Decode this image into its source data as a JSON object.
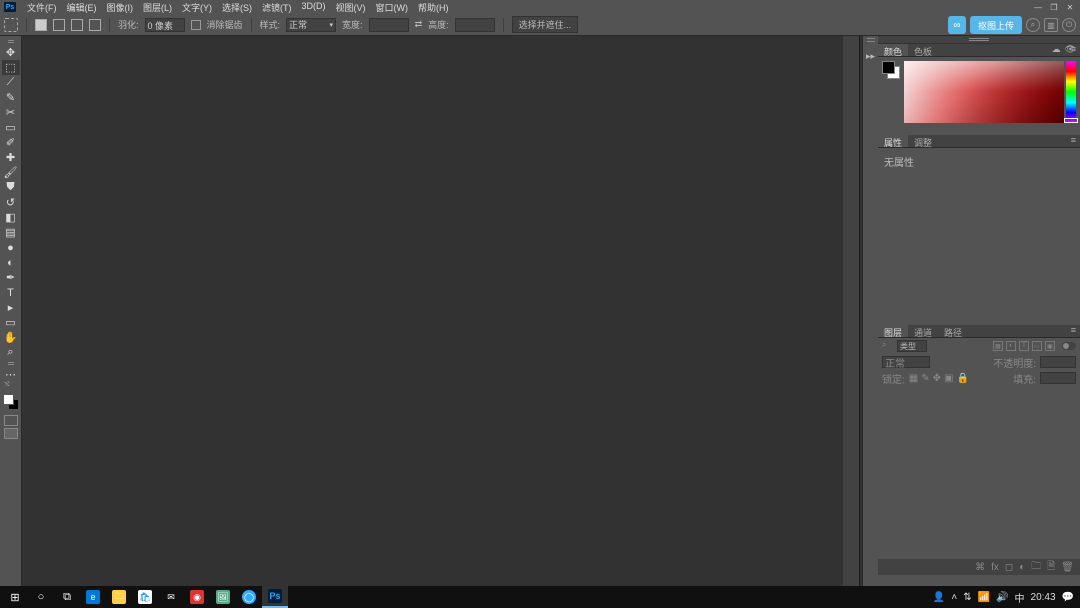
{
  "app": {
    "short": "Ps"
  },
  "menu": [
    "文件(F)",
    "编辑(E)",
    "图像(I)",
    "图层(L)",
    "文字(Y)",
    "选择(S)",
    "滤镜(T)",
    "3D(D)",
    "视图(V)",
    "窗口(W)",
    "帮助(H)"
  ],
  "opts": {
    "feather_label": "羽化:",
    "feather_val": "0 像素",
    "anti_label": "消除锯齿",
    "style_label": "样式:",
    "style_val": "正常",
    "width_label": "宽度:",
    "height_label": "高度:",
    "mask_label": "选择并遮住..."
  },
  "share": {
    "btn": "抠图上传"
  },
  "panels": {
    "color": {
      "tab1": "颜色",
      "tab2": "色板"
    },
    "prop": {
      "tab1": "属性",
      "tab2": "调整",
      "empty": "无属性"
    },
    "layers": {
      "tab1": "图层",
      "tab2": "通道",
      "tab3": "路径",
      "kind": "类型",
      "mode": "正常",
      "opacity_lbl": "不透明度:",
      "lock_lbl": "锁定:",
      "fill_lbl": "填充:"
    }
  },
  "tray": {
    "ime": "中",
    "time": "20:43"
  }
}
